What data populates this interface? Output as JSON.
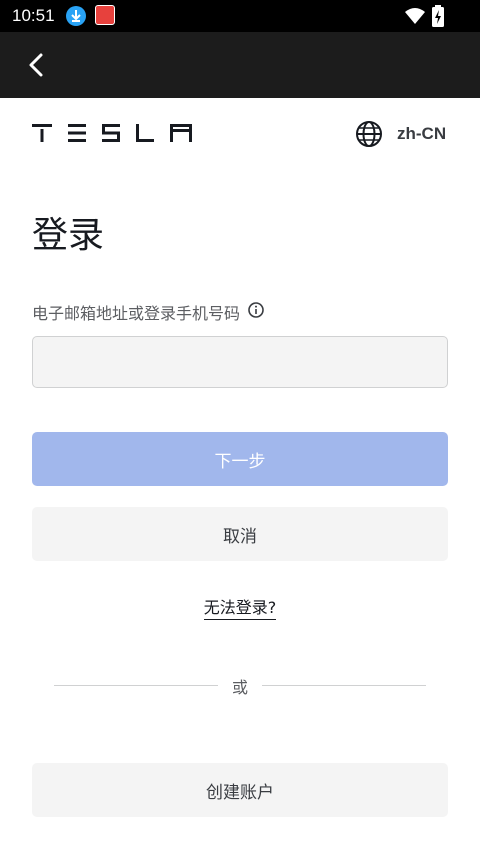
{
  "status_bar": {
    "time": "10:51",
    "icons": [
      "download-icon",
      "app-notification-icon",
      "wifi-icon",
      "battery-charging-icon"
    ]
  },
  "app_bar": {
    "back_icon": "chevron-left-icon"
  },
  "header": {
    "logo_text": "TESLA",
    "language": "zh-CN",
    "language_icon": "globe-icon"
  },
  "login": {
    "title": "登录",
    "field_label": "电子邮箱地址或登录手机号码",
    "field_value": "",
    "field_placeholder": "",
    "next_label": "下一步",
    "cancel_label": "取消",
    "cant_login_label": "无法登录?",
    "or_label": "或",
    "create_account_label": "创建账户"
  },
  "colors": {
    "primary_disabled": "#a1b7ec",
    "secondary_button": "#f4f4f4",
    "text_primary": "#171a20"
  }
}
